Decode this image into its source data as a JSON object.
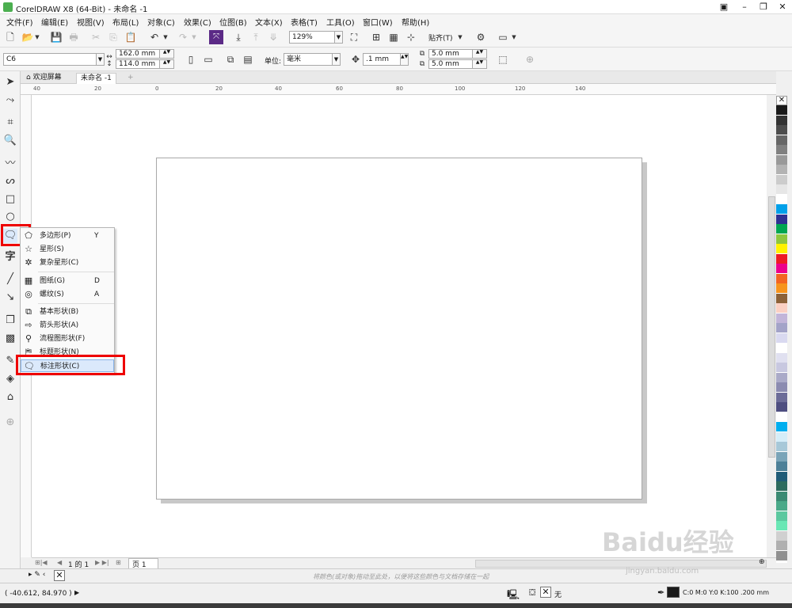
{
  "window": {
    "title": "CorelDRAW X8 (64-Bit) - 未命名 -1"
  },
  "menu": [
    "文件(F)",
    "编辑(E)",
    "视图(V)",
    "布局(L)",
    "对象(C)",
    "效果(C)",
    "位图(B)",
    "文本(X)",
    "表格(T)",
    "工具(O)",
    "窗口(W)",
    "帮助(H)"
  ],
  "toolbar": {
    "zoom": "129%",
    "snap_label": "贴齐(T)"
  },
  "propbar": {
    "preset": "C6",
    "width": "162.0 mm",
    "height": "114.0 mm",
    "unit_label": "单位:",
    "unit_value": "毫米",
    "nudge": ".1 mm",
    "dup_x": "5.0 mm",
    "dup_y": "5.0 mm"
  },
  "tabs": {
    "welcome": "欢迎屏幕",
    "doc": "未命名 -1"
  },
  "ruler_top": [
    "40",
    "20",
    "0",
    "20",
    "40",
    "60",
    "80",
    "100",
    "120",
    "140"
  ],
  "flyout": {
    "items": [
      {
        "label": "多边形(P)",
        "shortcut": "Y",
        "icon": "polygon-icon"
      },
      {
        "label": "星形(S)",
        "shortcut": "",
        "icon": "star-icon"
      },
      {
        "label": "复杂星形(C)",
        "shortcut": "",
        "icon": "complex-star-icon"
      },
      {
        "label": "图纸(G)",
        "shortcut": "D",
        "icon": "graph-paper-icon"
      },
      {
        "label": "螺纹(S)",
        "shortcut": "A",
        "icon": "spiral-icon"
      },
      {
        "label": "基本形状(B)",
        "shortcut": "",
        "icon": "basic-shapes-icon"
      },
      {
        "label": "箭头形状(A)",
        "shortcut": "",
        "icon": "arrow-shapes-icon"
      },
      {
        "label": "流程图形状(F)",
        "shortcut": "",
        "icon": "flowchart-shapes-icon"
      },
      {
        "label": "标题形状(N)",
        "shortcut": "",
        "icon": "banner-shapes-icon"
      },
      {
        "label": "标注形状(C)",
        "shortcut": "",
        "icon": "callout-shapes-icon"
      }
    ]
  },
  "pagebar": {
    "page_info": "1 的 1",
    "page_tab": "页 1"
  },
  "docbar": {
    "hint": "将颜色(或对象)拖动至此处，以便将这些颜色与文档存储在一起"
  },
  "status": {
    "coords": "( -40.612, 84.970 )",
    "fill_none": "无",
    "outline": "C:0 M:0 Y:0 K:100  .200 mm"
  },
  "palette": [
    "#1a1a1a",
    "#333333",
    "#4d4d4d",
    "#666666",
    "#808080",
    "#999999",
    "#b3b3b3",
    "#cccccc",
    "#e6e6e6",
    "#ffffff",
    "#00a0e9",
    "#2e3192",
    "#00a651",
    "#8dc63f",
    "#fff200",
    "#ed1c24",
    "#ec008c",
    "#f26522",
    "#f7941d",
    "#8c6239",
    "#fbd0c3",
    "#c2b5d9",
    "#a3a3c8",
    "#d9d9f0",
    "#ffffff",
    "#e0e0f0",
    "#c8c8e0",
    "#aaaac8",
    "#8b8bb0",
    "#6c6c98",
    "#4e4e80",
    "#ffffff",
    "#00aeef",
    "#d5edf8",
    "#a7c8d8",
    "#7aa4b8",
    "#4d8098",
    "#205c78",
    "#2d6b5e",
    "#3b8a73",
    "#4aa989",
    "#5bc89f",
    "#6ae7b5",
    "#d0d0d0",
    "#b0b0b0",
    "#909090"
  ],
  "watermark": {
    "logo": "Baidu经验",
    "url": "jingyan.baidu.com"
  }
}
